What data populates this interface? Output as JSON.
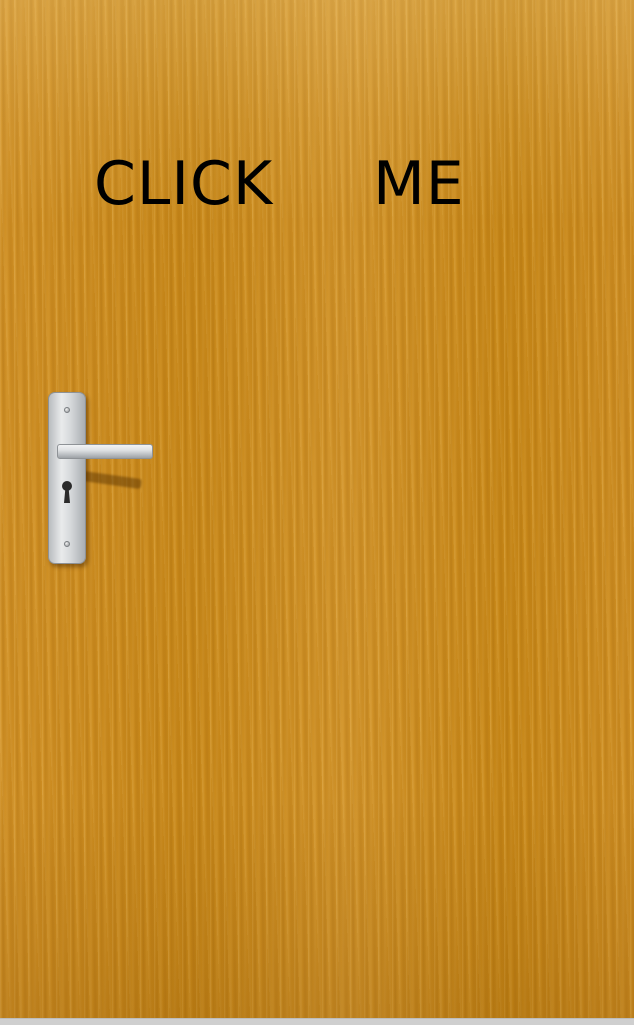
{
  "door": {
    "label_left": "CLICK",
    "label_right": "ME"
  },
  "handle": {
    "lever_icon": "door-lever-icon",
    "keyhole_icon": "keyhole-icon",
    "screw_icon": "screw-icon"
  },
  "colors": {
    "wood_base": "#c98a1f",
    "text": "#000000",
    "metal": "#d6d9db"
  }
}
